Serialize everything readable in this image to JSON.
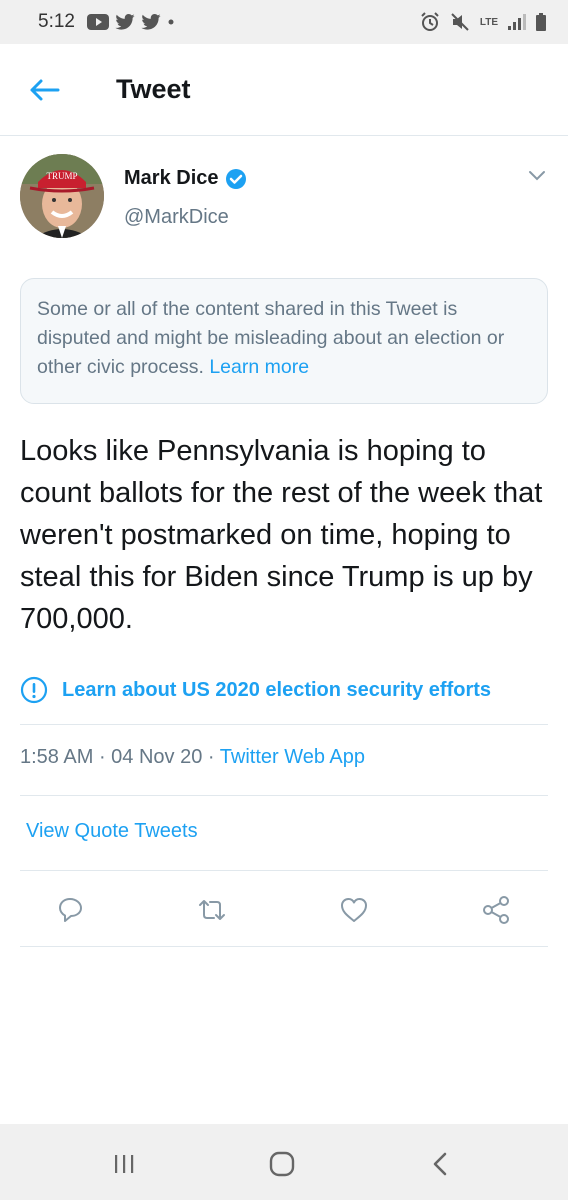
{
  "status_bar": {
    "time": "5:12",
    "network": "LTE"
  },
  "header": {
    "title": "Tweet"
  },
  "author": {
    "name": "Mark Dice",
    "handle": "@MarkDice",
    "avatar_hat_text": "TRUMP",
    "verified": true
  },
  "notice": {
    "text": "Some or all of the content shared in this Tweet is disputed and might be misleading about an election or other civic process.",
    "link_label": "Learn more"
  },
  "tweet": {
    "text": "Looks like Pennsylvania is hoping to count ballots for the rest of the week that weren't postmarked on time, hoping to steal this for Biden since Trump is up by 700,000."
  },
  "election_label": {
    "text": "Learn about US 2020 election security efforts"
  },
  "meta": {
    "time": "1:58 AM",
    "sep1": " · ",
    "date": "04 Nov 20",
    "sep2": " · ",
    "app": "Twitter Web App"
  },
  "quote_tweets": {
    "label": "View Quote Tweets"
  },
  "actions": [
    "reply-icon",
    "retweet-icon",
    "like-icon",
    "share-icon"
  ],
  "colors": {
    "accent": "#1da1f2",
    "secondary_text": "#657786",
    "hat_red": "#c8202f"
  }
}
